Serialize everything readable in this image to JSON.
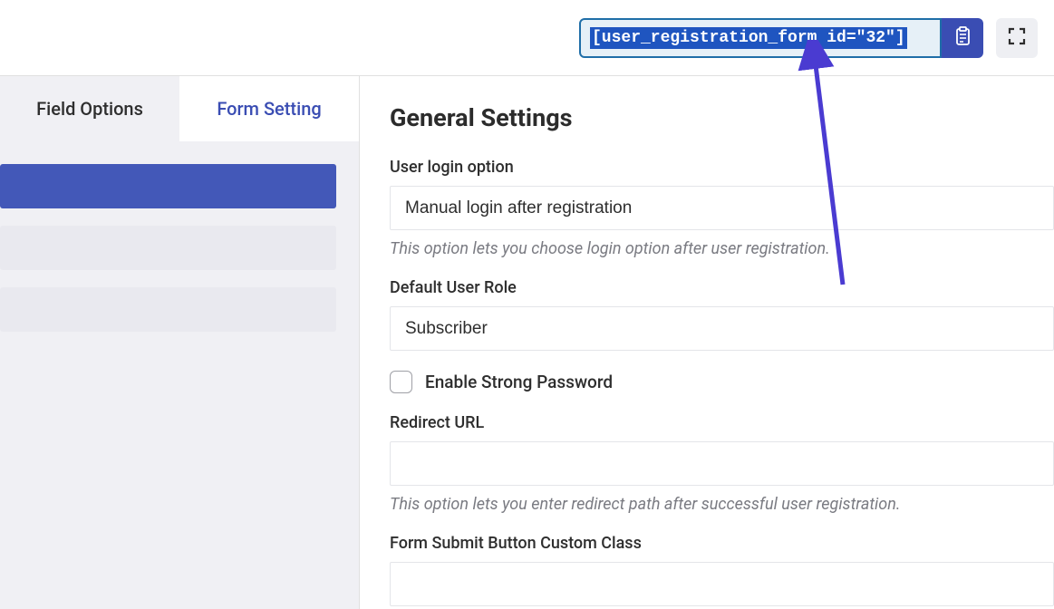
{
  "topbar": {
    "shortcode": "[user_registration_form id=\"32\"]"
  },
  "tabs": {
    "field_options": "Field Options",
    "form_setting": "Form Setting"
  },
  "main": {
    "title": "General Settings",
    "userLogin": {
      "label": "User login option",
      "value": "Manual login after registration",
      "help": "This option lets you choose login option after user registration."
    },
    "userRole": {
      "label": "Default User Role",
      "value": "Subscriber"
    },
    "strongPassword": {
      "label": "Enable Strong Password"
    },
    "redirect": {
      "label": "Redirect URL",
      "value": "",
      "help": "This option lets you enter redirect path after successful user registration."
    },
    "submitClass": {
      "label": "Form Submit Button Custom Class",
      "value": ""
    }
  }
}
